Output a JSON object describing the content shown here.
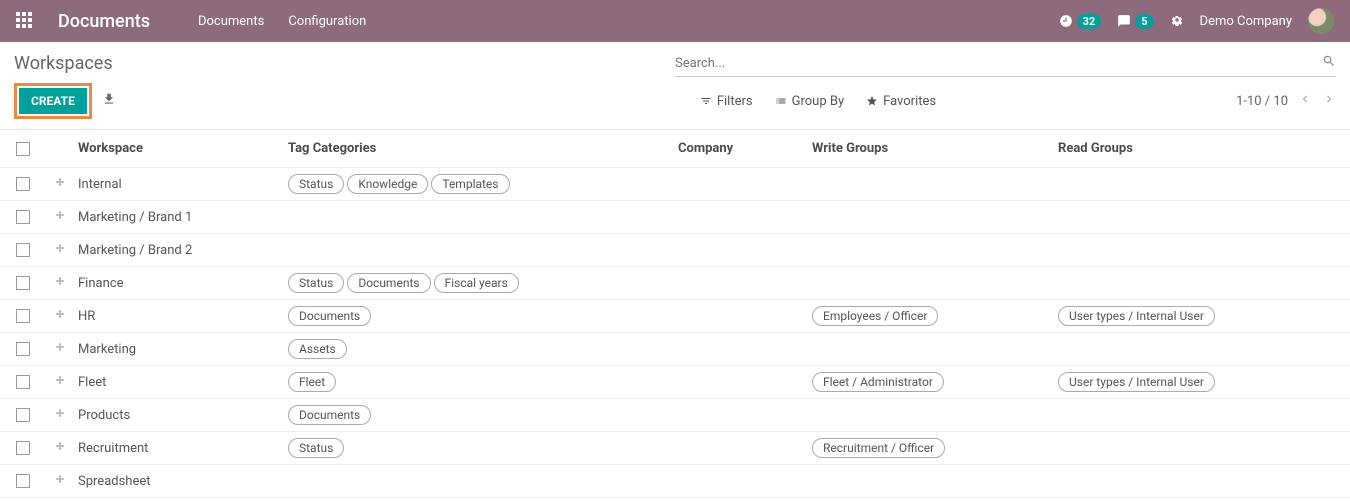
{
  "topbar": {
    "title": "Documents",
    "nav": [
      "Documents",
      "Configuration"
    ],
    "timer_badge": "32",
    "chat_badge": "5",
    "company": "Demo Company"
  },
  "subheader": {
    "page_title": "Workspaces",
    "search_placeholder": "Search..."
  },
  "toolbar": {
    "create_label": "CREATE",
    "filters": "Filters",
    "group_by": "Group By",
    "favorites": "Favorites",
    "pager": "1-10 / 10"
  },
  "columns": {
    "workspace": "Workspace",
    "tag_categories": "Tag Categories",
    "company": "Company",
    "write_groups": "Write Groups",
    "read_groups": "Read Groups"
  },
  "rows": [
    {
      "workspace": "Internal",
      "tags": [
        "Status",
        "Knowledge",
        "Templates"
      ],
      "write_groups": [],
      "read_groups": []
    },
    {
      "workspace": "Marketing / Brand 1",
      "tags": [],
      "write_groups": [],
      "read_groups": []
    },
    {
      "workspace": "Marketing / Brand 2",
      "tags": [],
      "write_groups": [],
      "read_groups": []
    },
    {
      "workspace": "Finance",
      "tags": [
        "Status",
        "Documents",
        "Fiscal years"
      ],
      "write_groups": [],
      "read_groups": []
    },
    {
      "workspace": "HR",
      "tags": [
        "Documents"
      ],
      "write_groups": [
        "Employees / Officer"
      ],
      "read_groups": [
        "User types / Internal User"
      ]
    },
    {
      "workspace": "Marketing",
      "tags": [
        "Assets"
      ],
      "write_groups": [],
      "read_groups": []
    },
    {
      "workspace": "Fleet",
      "tags": [
        "Fleet"
      ],
      "write_groups": [
        "Fleet / Administrator"
      ],
      "read_groups": [
        "User types / Internal User"
      ]
    },
    {
      "workspace": "Products",
      "tags": [
        "Documents"
      ],
      "write_groups": [],
      "read_groups": []
    },
    {
      "workspace": "Recruitment",
      "tags": [
        "Status"
      ],
      "write_groups": [
        "Recruitment / Officer"
      ],
      "read_groups": []
    },
    {
      "workspace": "Spreadsheet",
      "tags": [],
      "write_groups": [],
      "read_groups": []
    }
  ]
}
